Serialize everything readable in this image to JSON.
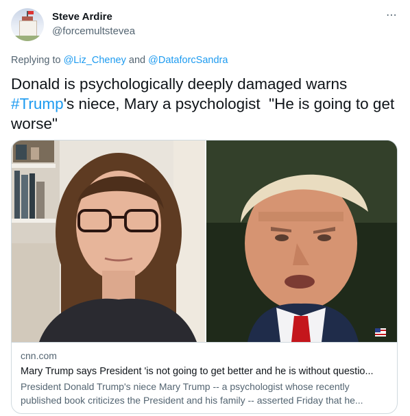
{
  "author": {
    "name": "Steve Ardire",
    "handle": "@forcemultstevea"
  },
  "more_icon": "⋯",
  "reply": {
    "prefix": "Replying to ",
    "user1": "@Liz_Cheney",
    "conj": " and ",
    "user2": "@DataforcSandra"
  },
  "tweet": {
    "part1": "Donald is psychologically deeply damaged warns ",
    "hashtag": "#Trump",
    "part2": "'s niece, Mary a psychologist  \"He is going to get worse\""
  },
  "card": {
    "domain": "cnn.com",
    "title": "Mary Trump says President 'is not going to get better and he is without questio...",
    "description": "President Donald Trump's niece Mary Trump -- a psychologist whose recently published book criticizes the President and his family -- asserted Friday that he..."
  },
  "colors": {
    "accent": "#1d9bf0",
    "secondary_text": "#536471",
    "border": "#cfd9de"
  },
  "icons": [
    "more-options-icon"
  ]
}
